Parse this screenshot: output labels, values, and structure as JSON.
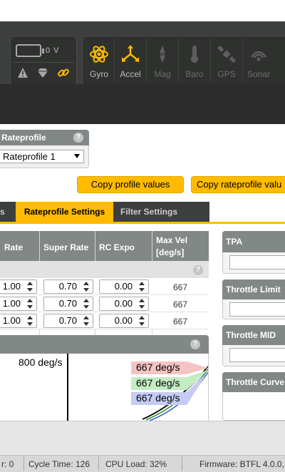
{
  "battery": {
    "voltage": "0 V"
  },
  "sensors": [
    {
      "label": "Gyro",
      "active": true,
      "icon": "gyro-icon"
    },
    {
      "label": "Accel",
      "active": true,
      "icon": "accel-icon"
    },
    {
      "label": "Mag",
      "active": false,
      "icon": "compass-icon"
    },
    {
      "label": "Baro",
      "active": false,
      "icon": "thermometer-icon"
    },
    {
      "label": "GPS",
      "active": false,
      "icon": "satellite-icon"
    },
    {
      "label": "Sonar",
      "active": false,
      "icon": "sonar-icon"
    }
  ],
  "rateprofile": {
    "title": "Rateprofile",
    "selected": "Rateprofile 1"
  },
  "buttons": {
    "copy_profile": "Copy profile values",
    "copy_rateprofile": "Copy rateprofile valu"
  },
  "tabs": [
    {
      "label": "s",
      "active": false
    },
    {
      "label": "Rateprofile Settings",
      "active": true
    },
    {
      "label": "Filter Settings",
      "active": false
    }
  ],
  "table": {
    "headers": {
      "rate": "Rate",
      "super_rate": "Super Rate",
      "rc_expo": "RC Expo",
      "max_vel": "Max Vel [deg/s]"
    },
    "rows": [
      {
        "rate": "1.00",
        "super_rate": "0.70",
        "rc_expo": "0.00",
        "max_vel": "667"
      },
      {
        "rate": "1.00",
        "super_rate": "0.70",
        "rc_expo": "0.00",
        "max_vel": "667"
      },
      {
        "rate": "1.00",
        "super_rate": "0.70",
        "rc_expo": "0.00",
        "max_vel": "667"
      }
    ]
  },
  "graph": {
    "max_label": "800 deg/s",
    "legend": [
      {
        "text": "667 deg/s",
        "color": "#f4c4c4"
      },
      {
        "text": "667 deg/s",
        "color": "#c4ecc4"
      },
      {
        "text": "667 deg/s",
        "color": "#c4ccf4"
      }
    ]
  },
  "right_panels": {
    "tpa": "TPA",
    "throttle_limit": "Throttle Limit",
    "throttle_mid": "Throttle MID",
    "throttle_curve": "Throttle Curve"
  },
  "status_bar": {
    "error": "r: 0",
    "cycle_time": "Cycle Time: 126",
    "cpu_load": "CPU Load: 32%",
    "firmware": "Firmware: BTFL 4.0.0,"
  },
  "colors": {
    "accent": "#ffbb00",
    "header_bg": "#3d3f3e",
    "panel_head": "#828885"
  }
}
